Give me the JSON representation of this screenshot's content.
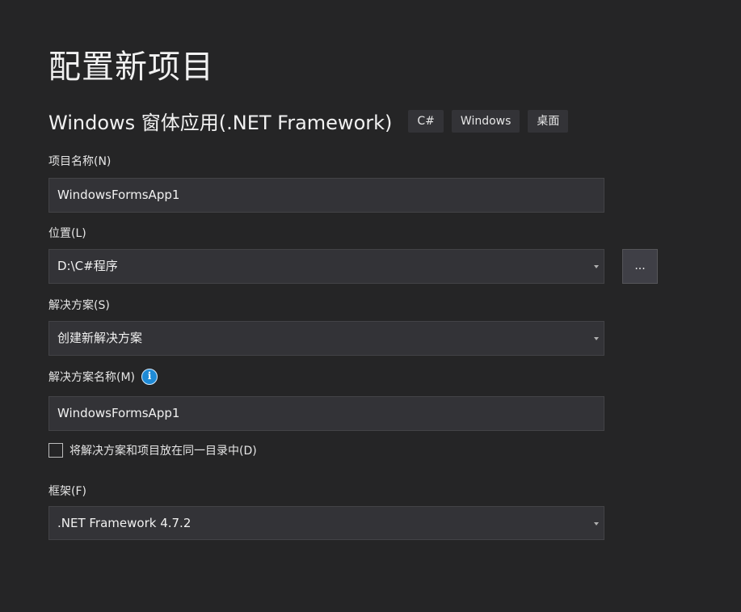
{
  "page": {
    "title": "配置新项目"
  },
  "template": {
    "name": "Windows 窗体应用(.NET Framework)",
    "tags": [
      "C#",
      "Windows",
      "桌面"
    ]
  },
  "fields": {
    "project_name": {
      "label": "项目名称(N)",
      "value": "WindowsFormsApp1"
    },
    "location": {
      "label": "位置(L)",
      "value": "D:\\C#程序",
      "browse_label": "..."
    },
    "solution": {
      "label": "解决方案(S)",
      "value": "创建新解决方案"
    },
    "solution_name": {
      "label": "解决方案名称(M)",
      "value": "WindowsFormsApp1",
      "info_icon": "i"
    },
    "same_dir": {
      "label": "将解决方案和项目放在同一目录中(D)",
      "checked": false
    },
    "framework": {
      "label": "框架(F)",
      "value": ".NET Framework 4.7.2"
    }
  },
  "colors": {
    "background": "#252526",
    "input_bg": "#333337",
    "info_blue": "#1e8ad6"
  }
}
